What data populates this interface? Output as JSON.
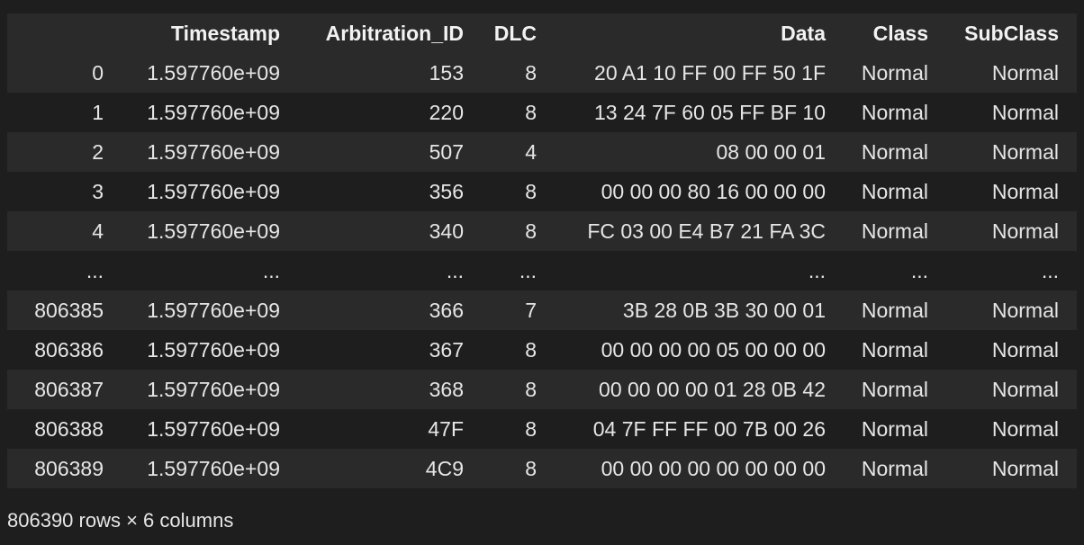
{
  "table": {
    "columns": [
      "",
      "Timestamp",
      "Arbitration_ID",
      "DLC",
      "Data",
      "Class",
      "SubClass"
    ],
    "rows": [
      [
        "0",
        "1.597760e+09",
        "153",
        "8",
        "20 A1 10 FF 00 FF 50 1F",
        "Normal",
        "Normal"
      ],
      [
        "1",
        "1.597760e+09",
        "220",
        "8",
        "13 24 7F 60 05 FF BF 10",
        "Normal",
        "Normal"
      ],
      [
        "2",
        "1.597760e+09",
        "507",
        "4",
        "08 00 00 01",
        "Normal",
        "Normal"
      ],
      [
        "3",
        "1.597760e+09",
        "356",
        "8",
        "00 00 00 80 16 00 00 00",
        "Normal",
        "Normal"
      ],
      [
        "4",
        "1.597760e+09",
        "340",
        "8",
        "FC 03 00 E4 B7 21 FA 3C",
        "Normal",
        "Normal"
      ],
      [
        "...",
        "...",
        "...",
        "...",
        "...",
        "...",
        "..."
      ],
      [
        "806385",
        "1.597760e+09",
        "366",
        "7",
        "3B 28 0B 3B 30 00 01",
        "Normal",
        "Normal"
      ],
      [
        "806386",
        "1.597760e+09",
        "367",
        "8",
        "00 00 00 00 05 00 00 00",
        "Normal",
        "Normal"
      ],
      [
        "806387",
        "1.597760e+09",
        "368",
        "8",
        "00 00 00 00 01 28 0B 42",
        "Normal",
        "Normal"
      ],
      [
        "806388",
        "1.597760e+09",
        "47F",
        "8",
        "04 7F FF FF 00 7B 00 26",
        "Normal",
        "Normal"
      ],
      [
        "806389",
        "1.597760e+09",
        "4C9",
        "8",
        "00 00 00 00 00 00 00 00",
        "Normal",
        "Normal"
      ]
    ]
  },
  "summary": "806390 rows × 6 columns",
  "colors": {
    "background": "#1e1e1e",
    "row_stripe": "#2a2a2a",
    "text": "#e6e6e6"
  }
}
